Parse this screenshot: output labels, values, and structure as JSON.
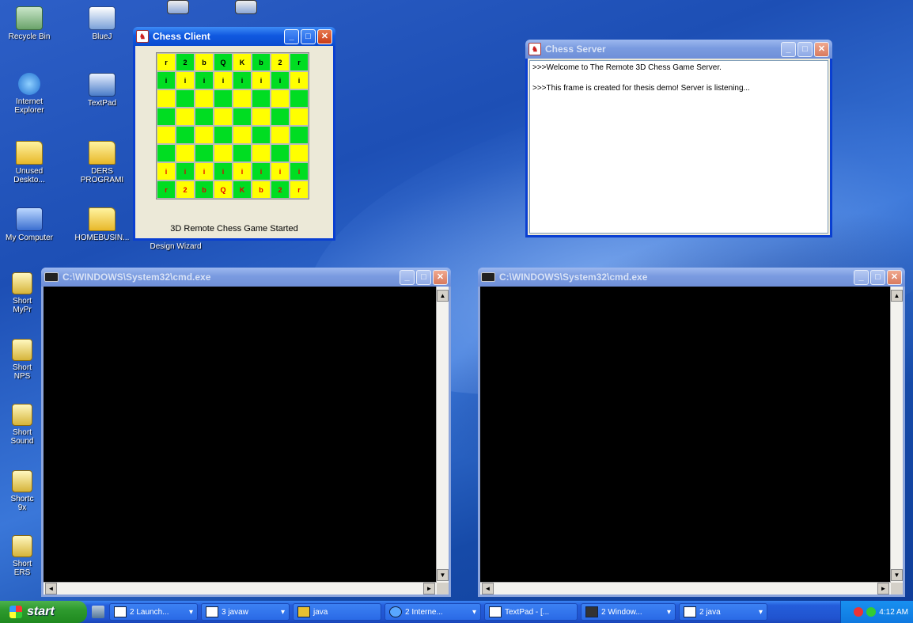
{
  "desktop": {
    "icons": [
      {
        "label": "Recycle Bin",
        "icon": "recycle-bin-icon"
      },
      {
        "label": "BlueJ",
        "icon": "bluej-icon"
      },
      {
        "label": "Internet Explorer",
        "icon": "internet-explorer-icon"
      },
      {
        "label": "TextPad",
        "icon": "textpad-icon"
      },
      {
        "label": "Unused Deskto...",
        "icon": "folder-icon"
      },
      {
        "label": "DERS PROGRAMI",
        "icon": "folder-icon"
      },
      {
        "label": "My Computer",
        "icon": "my-computer-icon"
      },
      {
        "label": "HOMEBUSIN...",
        "icon": "folder-icon"
      },
      {
        "label": "Design Wizard",
        "icon": "design-wizard-icon"
      },
      {
        "label": "Short MyPr",
        "icon": "shortcut-icon"
      },
      {
        "label": "Short NPS",
        "icon": "shortcut-icon"
      },
      {
        "label": "Short Sound",
        "icon": "shortcut-icon"
      },
      {
        "label": "Shortc 9x",
        "icon": "shortcut-icon"
      },
      {
        "label": "Short ERS",
        "icon": "shortcut-icon"
      }
    ]
  },
  "chess_client": {
    "title": "Chess Client",
    "status": "3D Remote Chess Game Started",
    "board": [
      [
        "r",
        "2",
        "b",
        "Q",
        "K",
        "b",
        "2",
        "r"
      ],
      [
        "i",
        "i",
        "i",
        "i",
        "i",
        "i",
        "i",
        "i"
      ],
      [
        "",
        "",
        "",
        "",
        "",
        "",
        "",
        ""
      ],
      [
        "",
        "",
        "",
        "",
        "",
        "",
        "",
        ""
      ],
      [
        "",
        "",
        "",
        "",
        "",
        "",
        "",
        ""
      ],
      [
        "",
        "",
        "",
        "",
        "",
        "",
        "",
        ""
      ],
      [
        "i",
        "i",
        "i",
        "i",
        "i",
        "i",
        "i",
        "i"
      ],
      [
        "r",
        "2",
        "b",
        "Q",
        "K",
        "b",
        "2",
        "r"
      ]
    ],
    "colors": {
      "light": "#ffff00",
      "dark": "#00dd22",
      "top_pieces": "#000000",
      "bottom_pieces": "#e00000"
    }
  },
  "chess_server": {
    "title": "Chess Server",
    "lines": [
      ">>>Welcome to The Remote 3D Chess Game Server.",
      "",
      ">>>This frame is created for thesis demo! Server is listening..."
    ]
  },
  "cmd_left": {
    "title": "C:\\WINDOWS\\System32\\cmd.exe"
  },
  "cmd_right": {
    "title": "C:\\WINDOWS\\System32\\cmd.exe"
  },
  "taskbar": {
    "start_label": "start",
    "tasks": [
      {
        "label": "2 Launch...",
        "dropdown": true
      },
      {
        "label": "3 javaw",
        "dropdown": true
      },
      {
        "label": "java",
        "dropdown": false
      },
      {
        "label": "2 Interne...",
        "dropdown": true
      },
      {
        "label": "TextPad - [...",
        "dropdown": false
      },
      {
        "label": "2 Window...",
        "dropdown": true
      },
      {
        "label": "2 java",
        "dropdown": true
      }
    ],
    "clock": "4:12 AM"
  }
}
